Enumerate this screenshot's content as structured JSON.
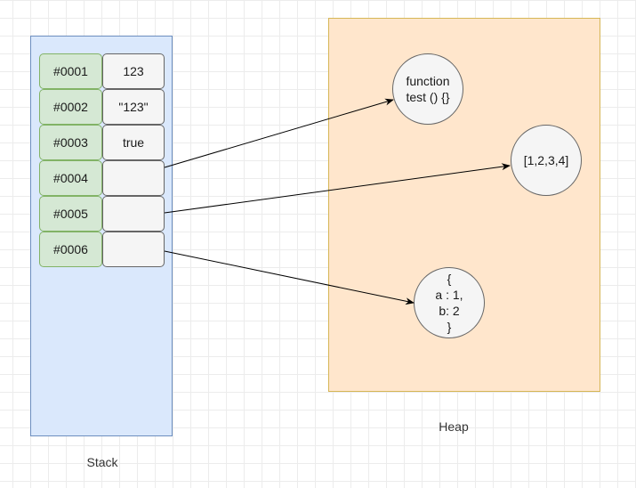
{
  "stack": {
    "label": "Stack",
    "rows": [
      {
        "address": "#0001",
        "value": "123"
      },
      {
        "address": "#0002",
        "value": "\"123\""
      },
      {
        "address": "#0003",
        "value": "true"
      },
      {
        "address": "#0004",
        "value": ""
      },
      {
        "address": "#0005",
        "value": ""
      },
      {
        "address": "#0006",
        "value": ""
      }
    ]
  },
  "heap": {
    "label": "Heap",
    "nodes": [
      {
        "text": "function\ntest () {}"
      },
      {
        "text": "[1,2,3,4]"
      },
      {
        "text": "{\na : 1,\nb: 2\n}"
      }
    ]
  },
  "references": [
    {
      "from": "#0004",
      "to": "function\ntest () {}"
    },
    {
      "from": "#0005",
      "to": "[1,2,3,4]"
    },
    {
      "from": "#0006",
      "to": "{\na : 1,\nb: 2\n}"
    }
  ],
  "colors": {
    "stack_fill": "#dae8fc",
    "stack_border": "#6c8ebf",
    "heap_fill": "#ffe6cc",
    "heap_border": "#d6b656",
    "address_fill": "#d5e8d4",
    "address_border": "#82b366",
    "value_fill": "#f5f5f5",
    "node_fill": "#f5f5f5",
    "arrow": "#000000"
  }
}
